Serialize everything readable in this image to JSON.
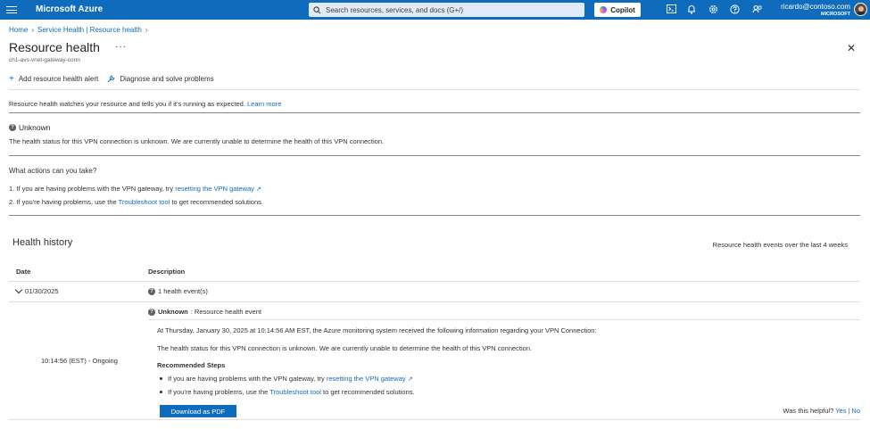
{
  "topbar": {
    "brand": "Microsoft Azure",
    "search_placeholder": "Search resources, services, and docs (G+/)",
    "copilot_label": "Copilot",
    "account_email": "ricardo@contoso.com",
    "account_tenant": "MICROSOFT",
    "icons": [
      "menu-icon",
      "search-icon",
      "cloud-shell-icon",
      "notifications-icon",
      "settings-icon",
      "help-icon",
      "feedback-icon"
    ]
  },
  "breadcrumb": [
    "Home",
    "Service Health | Resource health"
  ],
  "page": {
    "title": "Resource health",
    "more": "···",
    "subtitle": "ch1-avs-vnet-gateway-conn",
    "close": "✕"
  },
  "commands": {
    "add_alert": "Add resource health alert",
    "diagnose": "Diagnose and solve problems"
  },
  "intro": {
    "text": "Resource health watches your resource and tells you if it's running as expected.",
    "link": "Learn more"
  },
  "status": {
    "label": "Unknown",
    "description": "The health status for this VPN connection is unknown. We are currently unable to determine the health of this VPN connection."
  },
  "actions": {
    "heading": "What actions can you take?",
    "items": [
      {
        "prefix": "1.  If you are having problems with the VPN gateway, try ",
        "link": "resetting the VPN gateway",
        "suffix": ""
      },
      {
        "prefix": "2.  If you're having problems, use the ",
        "link": "Troubleshoot tool",
        "suffix": " to get recommended solutions."
      }
    ]
  },
  "history": {
    "title": "Health history",
    "range": "Resource health events over the last 4 weeks",
    "columns": [
      "Date",
      "Description"
    ],
    "row": {
      "date": "01/30/2025",
      "count": "1 health event(s)",
      "time": "10:14:56 (EST) - Ongoing",
      "event_status": "Unknown",
      "event_type": " : Resource health event",
      "line1": "At Thursday, January 30, 2025 at 10:14:56 AM EST, the Azure monitoring system received the following information regarding your VPN Connection:",
      "line2": "The health status for this VPN connection is unknown. We are currently unable to determine the health of this VPN connection.",
      "steps_title": "Recommended Steps",
      "steps": [
        {
          "prefix": "If you are having problems with the VPN gateway, try ",
          "link": "resetting the VPN gateway",
          "suffix": ""
        },
        {
          "prefix": "If you're having problems, use the ",
          "link": "Troubleshoot tool",
          "suffix": " to get recommended solutions."
        }
      ],
      "download": "Download as PDF"
    },
    "helpful": {
      "question": "Was this helpful?",
      "yes": "Yes",
      "no": "No"
    }
  }
}
